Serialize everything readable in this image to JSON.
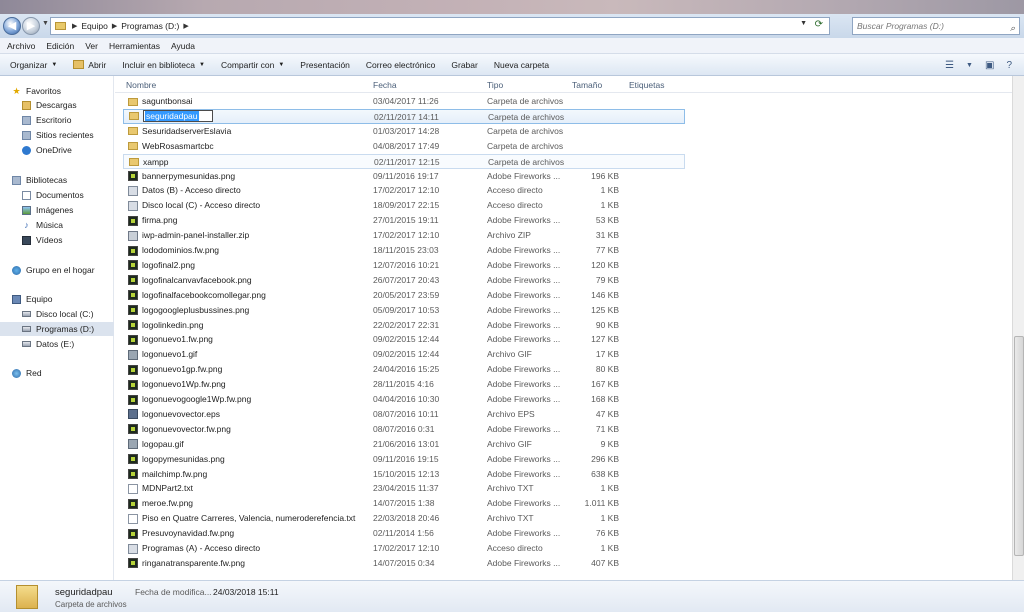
{
  "address": {
    "crumbs": [
      "Equipo",
      "Programas (D:)"
    ],
    "search_placeholder": "Buscar Programas (D:)"
  },
  "menu": [
    "Archivo",
    "Edición",
    "Ver",
    "Herramientas",
    "Ayuda"
  ],
  "toolbar": {
    "organize": "Organizar",
    "open": "Abrir",
    "include": "Incluir en biblioteca",
    "share": "Compartir con",
    "present": "Presentación",
    "email": "Correo electrónico",
    "burn": "Grabar",
    "new_folder": "Nueva carpeta"
  },
  "nav": {
    "favorites": "Favoritos",
    "downloads": "Descargas",
    "desktop": "Escritorio",
    "recent": "Sitios recientes",
    "onedrive": "OneDrive",
    "libraries": "Bibliotecas",
    "documents": "Documentos",
    "images": "Imágenes",
    "music": "Música",
    "videos": "Vídeos",
    "homegroup": "Grupo en el hogar",
    "computer": "Equipo",
    "drive_c": "Disco local (C:)",
    "drive_d": "Programas (D:)",
    "drive_e": "Datos  (E:)",
    "network": "Red"
  },
  "columns": {
    "name": "Nombre",
    "date": "Fecha",
    "type": "Tipo",
    "size": "Tamaño",
    "tags": "Etiquetas"
  },
  "rename_text": "seguridadpau",
  "files": [
    {
      "name": "saguntbonsai",
      "date": "03/04/2017 11:26",
      "type": "Carpeta de archivos",
      "size": "",
      "icon": "folder"
    },
    {
      "name": "",
      "date": "02/11/2017 14:11",
      "type": "Carpeta de archivos",
      "size": "",
      "icon": "folder"
    },
    {
      "name": "SesuridadserverEslavia",
      "date": "01/03/2017 14:28",
      "type": "Carpeta de archivos",
      "size": "",
      "icon": "folder"
    },
    {
      "name": "WebRosasmartcbc",
      "date": "04/08/2017 17:49",
      "type": "Carpeta de archivos",
      "size": "",
      "icon": "folder"
    },
    {
      "name": "xampp",
      "date": "02/11/2017 12:15",
      "type": "Carpeta de archivos",
      "size": "",
      "icon": "folder"
    },
    {
      "name": "bannerpymesunidas.png",
      "date": "09/11/2016 19:17",
      "type": "Adobe Fireworks ...",
      "size": "196 KB",
      "icon": "fw"
    },
    {
      "name": "Datos (B) - Acceso directo",
      "date": "17/02/2017 12:10",
      "type": "Acceso directo",
      "size": "1 KB",
      "icon": "lnk"
    },
    {
      "name": "Disco local (C) - Acceso directo",
      "date": "18/09/2017 22:15",
      "type": "Acceso directo",
      "size": "1 KB",
      "icon": "lnk"
    },
    {
      "name": "firma.png",
      "date": "27/01/2015 19:11",
      "type": "Adobe Fireworks ...",
      "size": "53 KB",
      "icon": "fw"
    },
    {
      "name": "iwp-admin-panel-installer.zip",
      "date": "17/02/2017 12:10",
      "type": "Archivo ZIP",
      "size": "31 KB",
      "icon": "zip"
    },
    {
      "name": "lododominios.fw.png",
      "date": "18/11/2015 23:03",
      "type": "Adobe Fireworks ...",
      "size": "77 KB",
      "icon": "fw"
    },
    {
      "name": "logofinal2.png",
      "date": "12/07/2016 10:21",
      "type": "Adobe Fireworks ...",
      "size": "120 KB",
      "icon": "fw"
    },
    {
      "name": "logofinalcanvavfacebook.png",
      "date": "26/07/2017 20:43",
      "type": "Adobe Fireworks ...",
      "size": "79 KB",
      "icon": "fw"
    },
    {
      "name": "logofinalfacebookcomollegar.png",
      "date": "20/05/2017 23:59",
      "type": "Adobe Fireworks ...",
      "size": "146 KB",
      "icon": "fw"
    },
    {
      "name": "logogoogleplusbussines.png",
      "date": "05/09/2017 10:53",
      "type": "Adobe Fireworks ...",
      "size": "125 KB",
      "icon": "fw"
    },
    {
      "name": "logolinkedin.png",
      "date": "22/02/2017 22:31",
      "type": "Adobe Fireworks ...",
      "size": "90 KB",
      "icon": "fw"
    },
    {
      "name": "logonuevo1.fw.png",
      "date": "09/02/2015 12:44",
      "type": "Adobe Fireworks ...",
      "size": "127 KB",
      "icon": "fw"
    },
    {
      "name": "logonuevo1.gif",
      "date": "09/02/2015 12:44",
      "type": "Archivo GIF",
      "size": "17 KB",
      "icon": "gif"
    },
    {
      "name": "logonuevo1gp.fw.png",
      "date": "24/04/2016 15:25",
      "type": "Adobe Fireworks ...",
      "size": "80 KB",
      "icon": "fw"
    },
    {
      "name": "logonuevo1Wp.fw.png",
      "date": "28/11/2015 4:16",
      "type": "Adobe Fireworks ...",
      "size": "167 KB",
      "icon": "fw"
    },
    {
      "name": "logonuevogoogle1Wp.fw.png",
      "date": "04/04/2016 10:30",
      "type": "Adobe Fireworks ...",
      "size": "168 KB",
      "icon": "fw"
    },
    {
      "name": "logonuevovector.eps",
      "date": "08/07/2016 10:11",
      "type": "Archivo EPS",
      "size": "47 KB",
      "icon": "eps"
    },
    {
      "name": "logonuevovector.fw.png",
      "date": "08/07/2016 0:31",
      "type": "Adobe Fireworks ...",
      "size": "71 KB",
      "icon": "fw"
    },
    {
      "name": "logopau.gif",
      "date": "21/06/2016 13:01",
      "type": "Archivo GIF",
      "size": "9 KB",
      "icon": "gif"
    },
    {
      "name": "logopymesunidas.png",
      "date": "09/11/2016 19:15",
      "type": "Adobe Fireworks ...",
      "size": "296 KB",
      "icon": "fw"
    },
    {
      "name": "mailchimp.fw.png",
      "date": "15/10/2015 12:13",
      "type": "Adobe Fireworks ...",
      "size": "638 KB",
      "icon": "fw"
    },
    {
      "name": "MDNPart2.txt",
      "date": "23/04/2015 11:37",
      "type": "Archivo TXT",
      "size": "1 KB",
      "icon": "txt"
    },
    {
      "name": "meroe.fw.png",
      "date": "14/07/2015 1:38",
      "type": "Adobe Fireworks ...",
      "size": "1.011 KB",
      "icon": "fw"
    },
    {
      "name": "Piso en Quatre Carreres, Valencia, numeroderefencia.txt",
      "date": "22/03/2018 20:46",
      "type": "Archivo TXT",
      "size": "1 KB",
      "icon": "txt"
    },
    {
      "name": "Presuvoynavidad.fw.png",
      "date": "02/11/2014 1:56",
      "type": "Adobe Fireworks ...",
      "size": "76 KB",
      "icon": "fw"
    },
    {
      "name": "Programas (A) - Acceso directo",
      "date": "17/02/2017 12:10",
      "type": "Acceso directo",
      "size": "1 KB",
      "icon": "lnk"
    },
    {
      "name": "ringanatransparente.fw.png",
      "date": "14/07/2015 0:34",
      "type": "Adobe Fireworks ...",
      "size": "407 KB",
      "icon": "fw"
    }
  ],
  "details": {
    "name": "seguridadpau",
    "type": "Carpeta de archivos",
    "date_label": "Fecha de modifica...",
    "date": "24/03/2018 15:11"
  }
}
